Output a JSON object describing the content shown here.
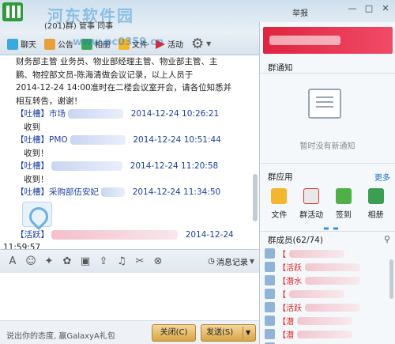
{
  "window": {
    "group_title": "(201)群) 管事 同事",
    "watermark": "河东软件园",
    "watermark_url": "www.pc0359.cn",
    "report": "举报",
    "minimize": "—",
    "maximize": "□",
    "close": "✕"
  },
  "toolbar": {
    "chat": "聊天",
    "notice": "公告",
    "album": "相册",
    "file": "文件",
    "activity": "活动"
  },
  "chat": {
    "lines": [
      "财务部主管 业务员、物业部经理主管、物业部主管、主",
      "鹏、物控部文员-陈海清做会议记录，以上人员于",
      "2014-12-24 14:00准时在二楼会议室开会，请各位知悉并",
      "相互转告，谢谢！"
    ],
    "messages": [
      {
        "head": "【吐槽】市场",
        "time": "2014-12-24 10:26:21",
        "body": "收到"
      },
      {
        "head": "【吐槽】PMO",
        "time": "2014-12-24 10:51:44",
        "body": "收到！"
      },
      {
        "head": "【吐槽】",
        "time": "2014-12-24 11:20:58",
        "body": "收到！"
      },
      {
        "head": "【吐槽】采购部伍安妃",
        "time": "2014-12-24 11:34:50",
        "body": ""
      },
      {
        "head": "【活跃】",
        "time": "2014-12-24",
        "time2": "11:59:57",
        "body": ""
      }
    ]
  },
  "input": {
    "history_label": "消息记录",
    "promo": "说出你的态度, 赢GalaxyA礼包",
    "close_btn": "关闭(C)",
    "send_btn": "发送(S)"
  },
  "right": {
    "notice_title": "群通知",
    "notice_empty": "暂时没有新通知",
    "apps_title": "群应用",
    "more": "更多",
    "apps": [
      "文件",
      "群活动",
      "签到",
      "相册"
    ],
    "members_title": "群成员(62/74)",
    "members": [
      {
        "tag": "【"
      },
      {
        "tag": "【活跃"
      },
      {
        "tag": "【潜水"
      },
      {
        "tag": "【"
      },
      {
        "tag": "【活跃"
      },
      {
        "tag": "【潜"
      },
      {
        "tag": "【潜"
      },
      {
        "tag": "【"
      }
    ]
  },
  "colors": {
    "accent": "#1f6fc2",
    "banner": "#e0243f",
    "button": "#d7a547"
  }
}
